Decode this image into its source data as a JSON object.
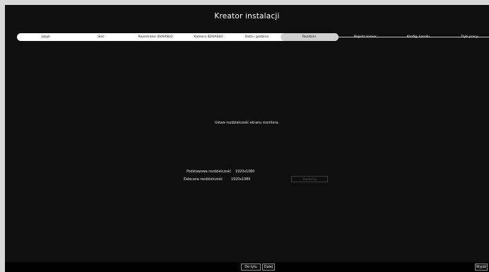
{
  "wizard": {
    "title": "Kreator instalacji",
    "steps": [
      {
        "label": "Język",
        "state": "done"
      },
      {
        "label": "Sieć",
        "state": "done"
      },
      {
        "label": "Rejestrator ID/HASŁO",
        "state": "done"
      },
      {
        "label": "Kamera ID/HASŁO",
        "state": "done"
      },
      {
        "label": "Data i godzina",
        "state": "done"
      },
      {
        "label": "Rozdziel.",
        "state": "current"
      },
      {
        "label": "Rejestr kamer",
        "state": "future"
      },
      {
        "label": "Konfig. kanału",
        "state": "future"
      },
      {
        "label": "Tryb pracy",
        "state": "future"
      }
    ]
  },
  "resolution": {
    "instruction": "Ustaw rozdzielczość ekranu monitora.",
    "basic_label": "Podstawowa rozdzielczość",
    "basic_value": "1920x1080",
    "recommended_label": "Zalecana rozdzielczość",
    "recommended_value": "1920x1080",
    "apply_label": "Zastosuj"
  },
  "footer": {
    "back_label": "Do tyłu",
    "next_label": "Dalej",
    "exit_label": "Wyjdź"
  },
  "colors": {
    "background": "#0f0f0f",
    "step_done": "#ffffff",
    "step_current": "#cfcfcf"
  }
}
